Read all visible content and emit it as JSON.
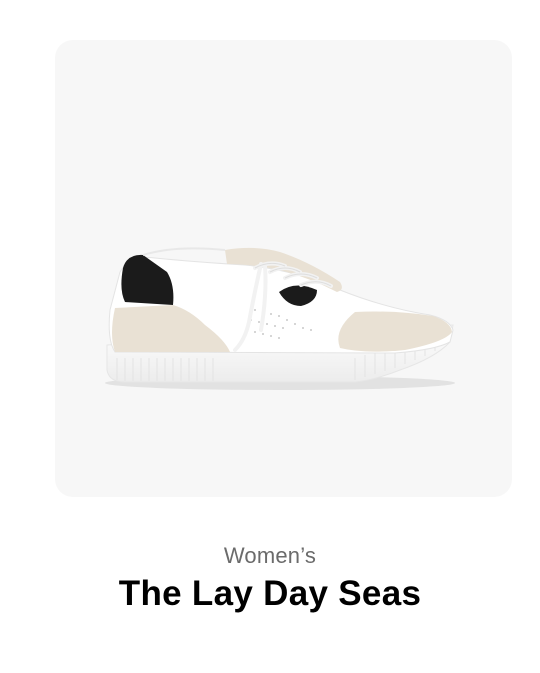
{
  "product": {
    "category": "Women’s",
    "name": "The Lay Day Seas",
    "image_icon": "sneaker-image"
  },
  "colors": {
    "panel_background": "#f7f7f7",
    "category_text": "#6b6b6b",
    "title_text": "#000000",
    "shoe_white": "#ffffff",
    "shoe_suede": "#e9e1d4",
    "shoe_black": "#1b1b1b"
  }
}
